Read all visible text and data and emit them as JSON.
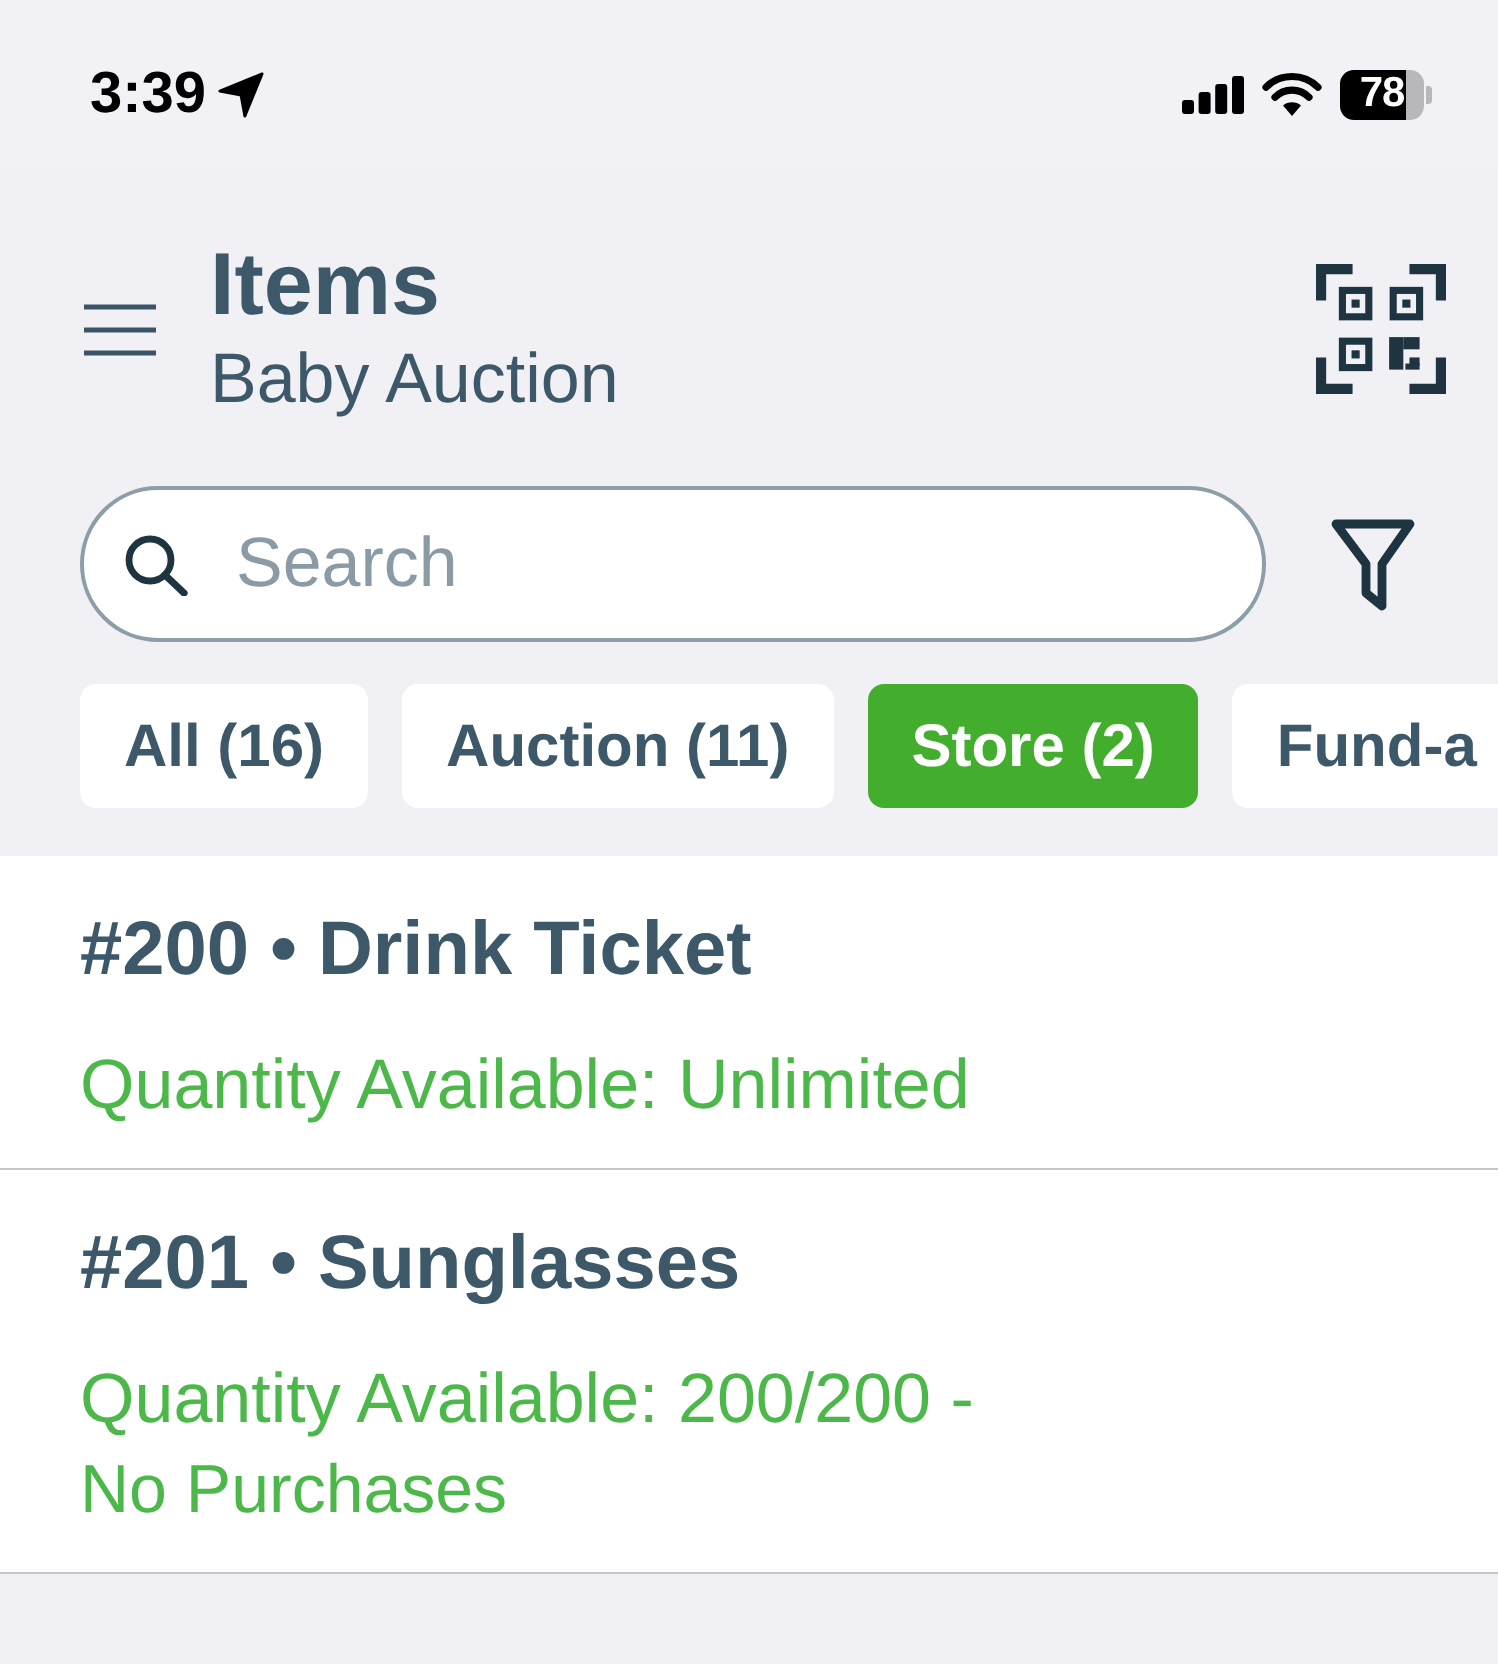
{
  "status_bar": {
    "time": "3:39",
    "battery": "78"
  },
  "header": {
    "title": "Items",
    "subtitle": "Baby Auction"
  },
  "search": {
    "placeholder": "Search"
  },
  "filter_chips": [
    {
      "label": "All (16)",
      "selected": false
    },
    {
      "label": "Auction (11)",
      "selected": false
    },
    {
      "label": "Store (2)",
      "selected": true
    },
    {
      "label": "Fund-a",
      "selected": false
    }
  ],
  "items": [
    {
      "title": "#200 • Drink Ticket",
      "quantity": "Quantity Available: Unlimited"
    },
    {
      "title": "#201 • Sunglasses",
      "quantity": "Quantity Available: 200/200 -",
      "note": "No Purchases"
    }
  ]
}
